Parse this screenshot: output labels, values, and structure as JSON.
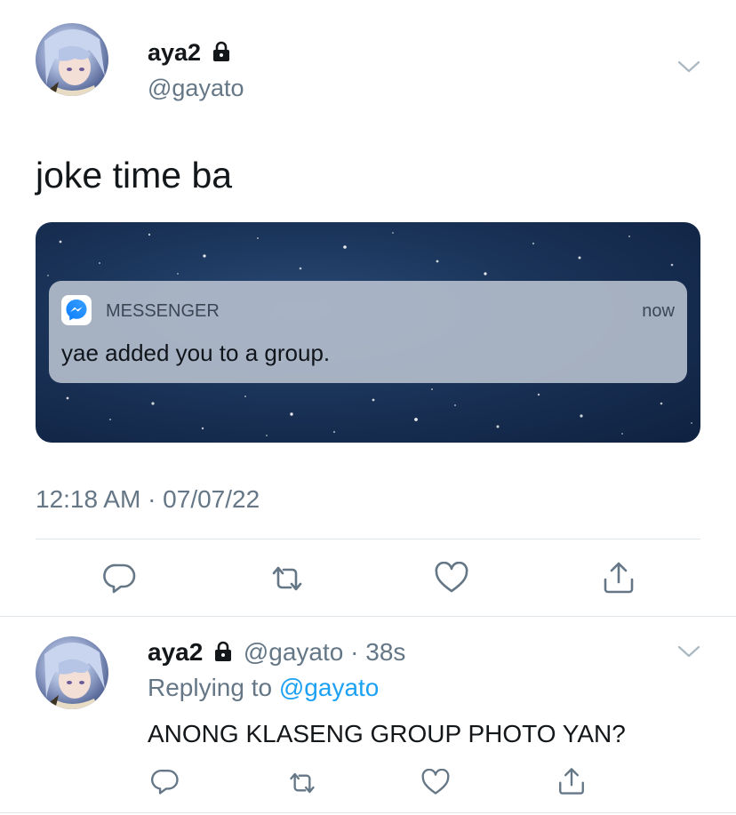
{
  "tweet": {
    "display_name": "aya2",
    "handle": "@gayato",
    "text": "joke time ba",
    "timestamp": "12:18 AM · 07/07/22",
    "media": {
      "notification": {
        "app_name": "MESSENGER",
        "time": "now",
        "message": "yae added you to a group."
      }
    },
    "actions": [
      "reply-icon",
      "retweet-icon",
      "like-icon",
      "share-icon"
    ]
  },
  "reply": {
    "display_name": "aya2",
    "handle": "@gayato",
    "separator": "·",
    "age": "38s",
    "replying_prefix": "Replying to",
    "replying_to": "@gayato",
    "text": "ANONG KLASENG GROUP PHOTO YAN?",
    "actions": [
      "reply-icon",
      "retweet-icon",
      "like-icon",
      "share-icon"
    ]
  },
  "colors": {
    "link": "#1da1f2",
    "secondary_text": "#657786",
    "icon": "#657786",
    "divider": "#e1e8ed"
  }
}
